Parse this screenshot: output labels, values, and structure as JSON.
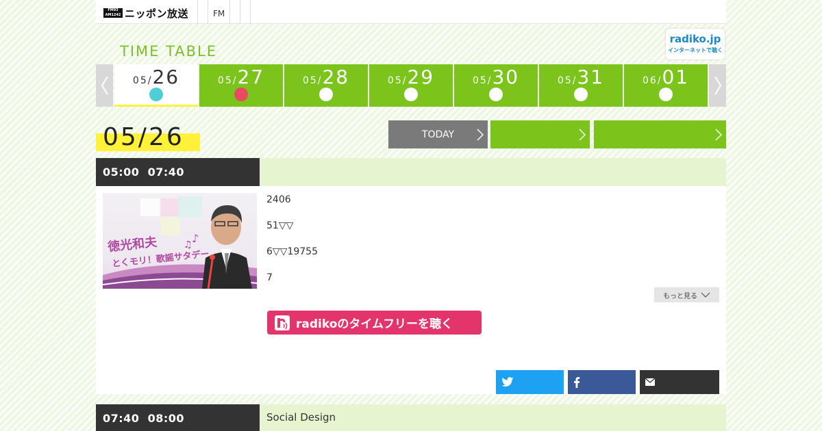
{
  "header": {
    "logo_mark_line1": "FM93",
    "logo_mark_line2": "AM1242",
    "logo_text": "ニッポン放送",
    "nav_item": "FM"
  },
  "radiko_badge": {
    "title": "radiko.jp",
    "subtitle": "インターネットで聴く"
  },
  "timetable_title": "TIME TABLE",
  "date_tabs": [
    {
      "month": "05/",
      "day": "26",
      "dot_color": "#4ccfd9",
      "active": true
    },
    {
      "month": "05/",
      "day": "27",
      "dot_color": "#e84a5f",
      "active": false
    },
    {
      "month": "05/",
      "day": "28",
      "dot_color": "#ffffff",
      "active": false
    },
    {
      "month": "05/",
      "day": "29",
      "dot_color": "#ffffff",
      "active": false
    },
    {
      "month": "05/",
      "day": "30",
      "dot_color": "#ffffff",
      "active": false
    },
    {
      "month": "05/",
      "day": "31",
      "dot_color": "#ffffff",
      "active": false
    },
    {
      "month": "06/",
      "day": "01",
      "dot_color": "#ffffff",
      "active": false
    }
  ],
  "current_date": "05/26",
  "actions": {
    "today_label": "TODAY",
    "prev_label": "",
    "next_label": ""
  },
  "programs": [
    {
      "start": "05:00",
      "end": "07:40",
      "title": "",
      "thumb_text_1": "徳光和夫",
      "thumb_text_2": "とくモリ！歌謡サタデー",
      "description": [
        "2406",
        "51▽▽",
        "6▽▽19755",
        "7"
      ],
      "more_label": "もっと見る",
      "radiko_label": "radikoのタイムフリーを聴く"
    },
    {
      "start": "07:40",
      "end": "08:00",
      "title": "Social Design"
    }
  ],
  "colors": {
    "accent_green": "#7ac41c",
    "highlight_yellow": "#fff238",
    "radiko_pink": "#e3356b",
    "twitter_blue": "#1da1f2",
    "facebook_blue": "#3b5998"
  }
}
